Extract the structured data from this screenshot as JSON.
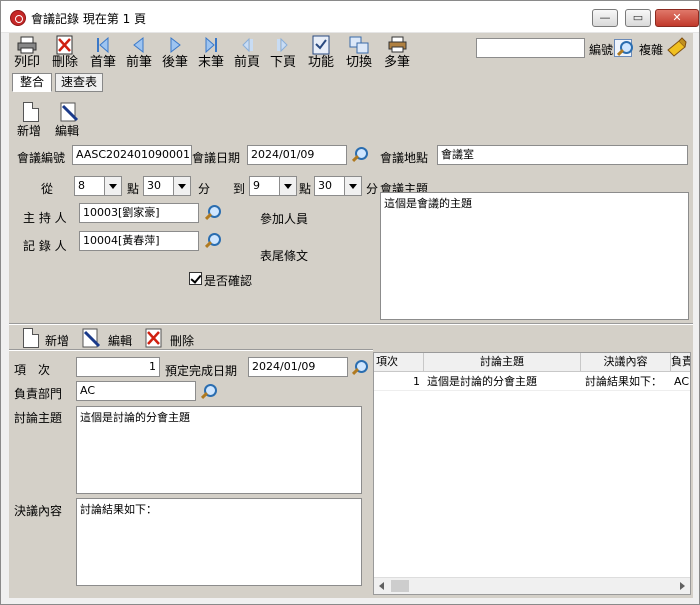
{
  "window": {
    "title": "會議記錄  現在第 1 頁"
  },
  "toolbar": {
    "items": [
      {
        "label": "列印",
        "icon": "printer-icon"
      },
      {
        "label": "刪除",
        "icon": "delete-icon"
      },
      {
        "label": "首筆",
        "icon": "first-record-icon"
      },
      {
        "label": "前筆",
        "icon": "prev-record-icon"
      },
      {
        "label": "後筆",
        "icon": "next-record-icon"
      },
      {
        "label": "末筆",
        "icon": "last-record-icon"
      },
      {
        "label": "前頁",
        "icon": "prev-page-icon"
      },
      {
        "label": "下頁",
        "icon": "next-page-icon"
      },
      {
        "label": "功能",
        "icon": "function-icon"
      },
      {
        "label": "切換",
        "icon": "switch-icon"
      },
      {
        "label": "多筆",
        "icon": "multi-record-icon"
      }
    ],
    "search_value": "",
    "number_label": "編號",
    "copy_label": "複雜"
  },
  "tabs": [
    {
      "label": "整合",
      "active": true
    },
    {
      "label": "速查表",
      "active": false
    }
  ],
  "master_actions": {
    "new_label": "新增",
    "edit_label": "編輯"
  },
  "meeting": {
    "id_label": "會議編號",
    "id_value": "AASC202401090001",
    "date_label": "會議日期",
    "date_value": "2024/01/09",
    "location_label": "會議地點",
    "location_value": "會議室",
    "from_label": "從",
    "from_hour": "8",
    "hour_label": "點",
    "from_min": "30",
    "min_label": "分",
    "to_label": "到",
    "to_hour": "9",
    "to_min": "30",
    "subject_label": "會議主題",
    "subject_value": "這個是會議的主題",
    "host_label": "主 持 人",
    "host_value": "10003[劉家豪]",
    "attendees_label": "參加人員",
    "recorder_label": "記 錄 人",
    "recorder_value": "10004[黃春萍]",
    "footer_label": "表尾條文",
    "confirmed_label": "是否確認",
    "confirmed": true
  },
  "detail_actions": {
    "new_label": "新增",
    "edit_label": "編輯",
    "delete_label": "刪除"
  },
  "detail": {
    "item_label": "項　次",
    "item_value": "1",
    "due_label": "預定完成日期",
    "due_value": "2024/01/09",
    "dept_label": "負責部門",
    "dept_value": "AC",
    "topic_label": "討論主題",
    "topic_value": "這個是討論的分會主題",
    "resolution_label": "決議內容",
    "resolution_value": "討論結果如下："
  },
  "grid": {
    "columns": [
      "項次",
      "討論主題",
      "決議內容",
      "負責"
    ],
    "rows": [
      {
        "item": "1",
        "topic": "這個是討論的分會主題",
        "resolution": "討論結果如下：",
        "dept": "AC"
      }
    ]
  }
}
